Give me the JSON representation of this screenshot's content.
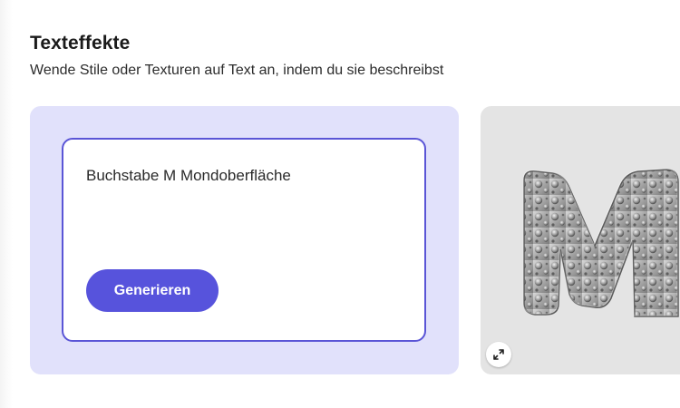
{
  "section": {
    "title": "Texteffekte",
    "subtitle": "Wende Stile oder Texturen auf Text an, indem du sie beschreibst"
  },
  "prompt": {
    "text": "Buchstabe M Mondoberfläche",
    "button_label": "Generieren"
  },
  "preview": {
    "image_icon": "moon-texture-letter-m-image",
    "expand_icon": "expand-arrows-icon"
  },
  "colors": {
    "accent": "#5753DC",
    "panel_background": "#E1E1FB",
    "card_border": "#5A55D6"
  }
}
